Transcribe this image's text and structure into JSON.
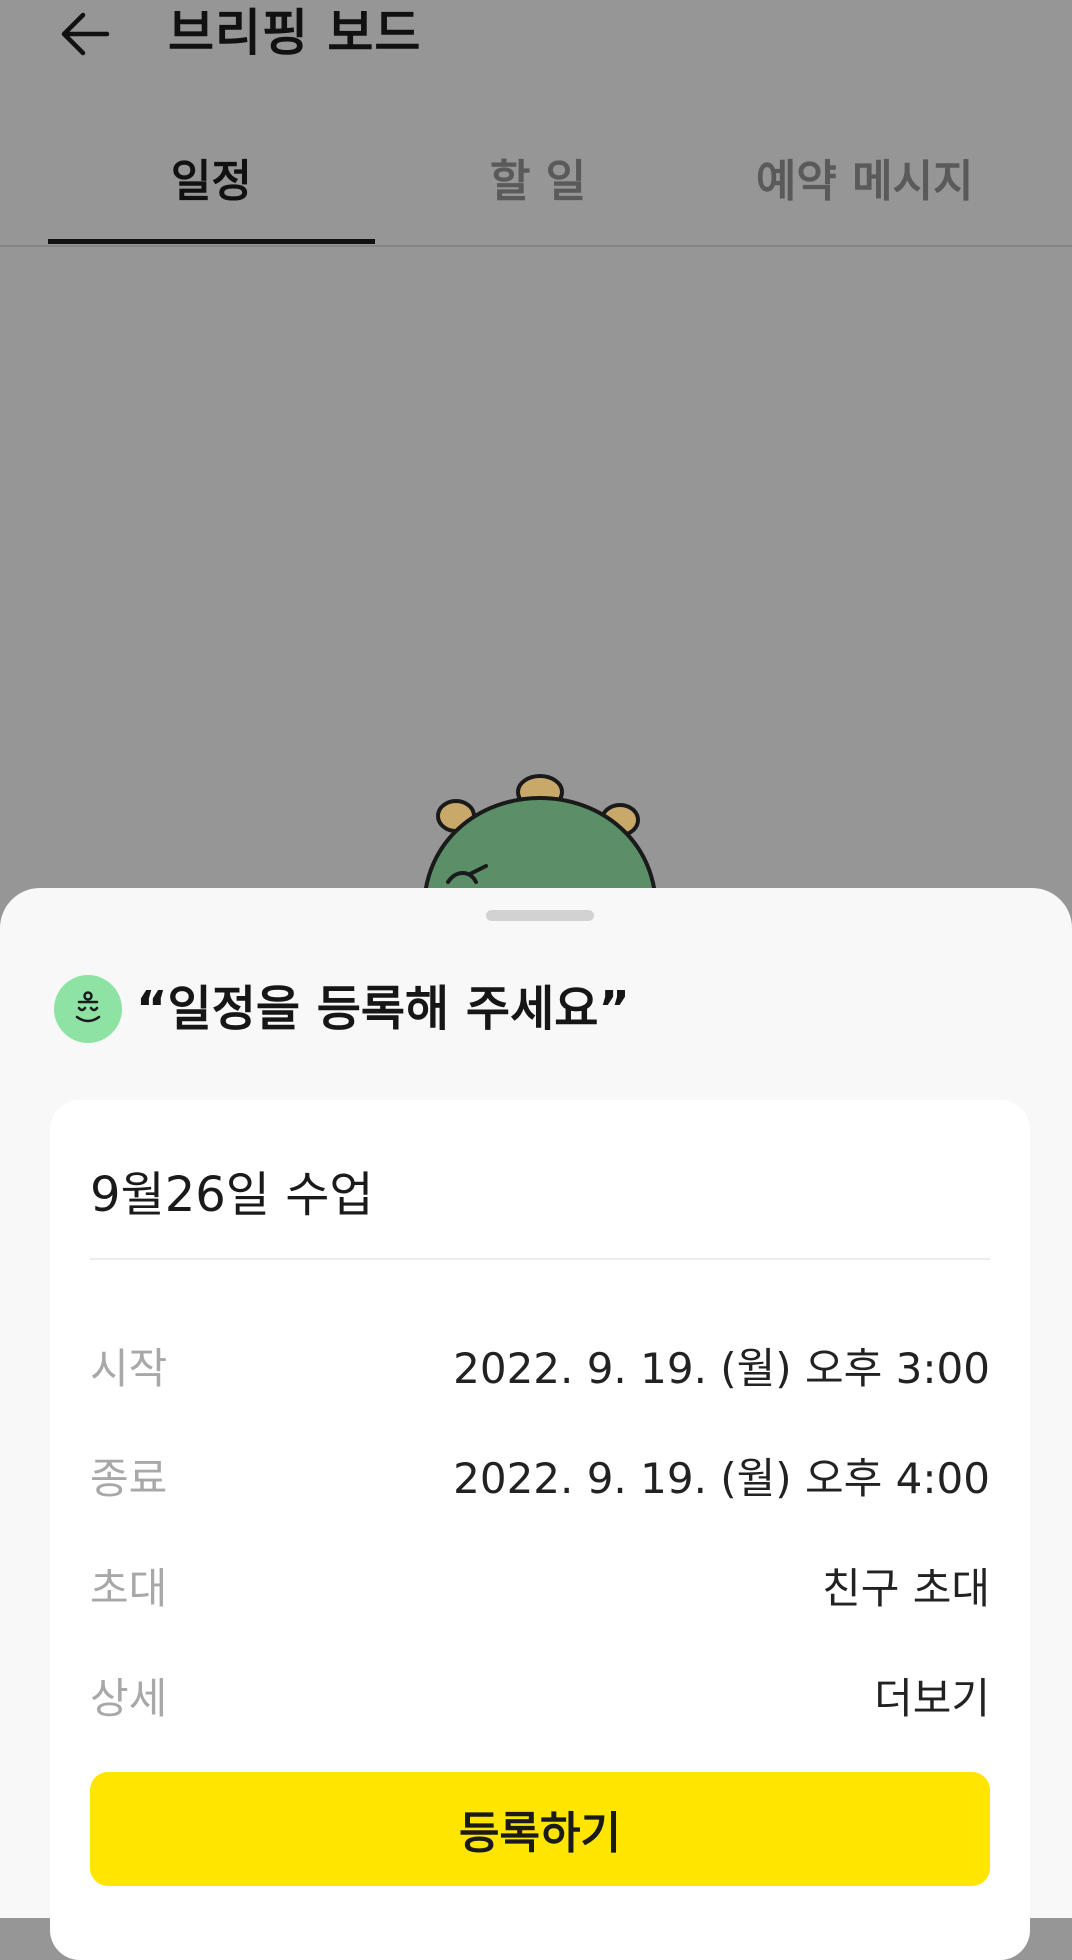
{
  "header": {
    "back_icon": "arrow-left-icon",
    "title": "브리핑 보드"
  },
  "tabs": [
    {
      "label": "일정",
      "active": true
    },
    {
      "label": "할 일",
      "active": false
    },
    {
      "label": "예약 메시지",
      "active": false
    }
  ],
  "sheet": {
    "avatar_icon": "bot-face-icon",
    "title": "“일정을 등록해 주세요”",
    "event_title": "9월26일 수업",
    "rows": [
      {
        "label": "시작",
        "value": "2022. 9. 19. (월) 오후 3:00"
      },
      {
        "label": "종료",
        "value": "2022. 9. 19. (월) 오후 4:00"
      },
      {
        "label": "초대",
        "value": "친구 초대"
      },
      {
        "label": "상세",
        "value": "더보기"
      }
    ],
    "register_label": "등록하기"
  },
  "colors": {
    "overlay": "#969696",
    "accent": "#ffe500",
    "avatar_bg": "#8ee3a4",
    "mascot": "#5a8f67"
  }
}
